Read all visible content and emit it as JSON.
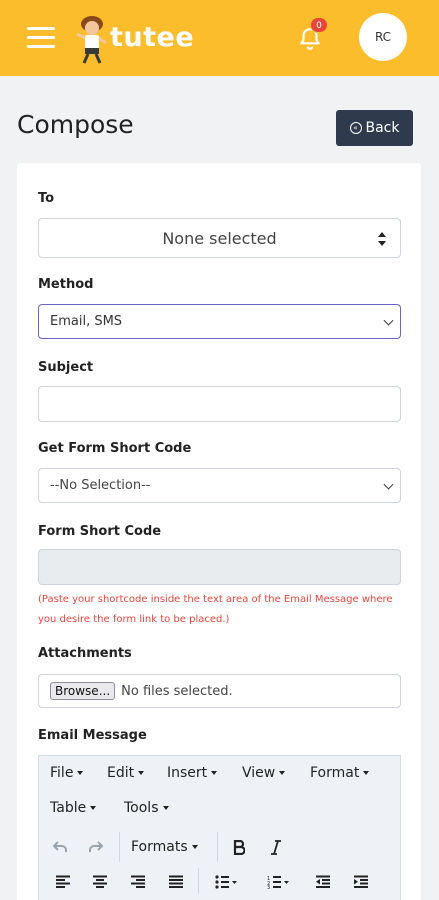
{
  "header": {
    "brand": "tutee",
    "notification_count": "0",
    "avatar_initials": "RC",
    "accent_color": "#fcbd2c"
  },
  "page": {
    "title": "Compose",
    "back_label": "Back"
  },
  "form": {
    "to_label": "To",
    "to_value": "None selected",
    "method_label": "Method",
    "method_value": "Email, SMS",
    "subject_label": "Subject",
    "subject_value": "",
    "form_short_code_select_label": "Get Form Short Code",
    "form_short_code_select_value": "--No Selection--",
    "form_short_code_label": "Form Short Code",
    "form_short_code_value": "",
    "hint": "(Paste your shortcode inside the text area of the Email Message where you desire the form link to be placed.)",
    "attachments_label": "Attachments",
    "browse_label": "Browse...",
    "no_files": "No files selected.",
    "email_message_label": "Email Message"
  },
  "editor": {
    "menus": [
      "File",
      "Edit",
      "Insert",
      "View",
      "Format",
      "Table",
      "Tools"
    ],
    "formats_label": "Formats",
    "toolbar_icons": [
      "undo-icon",
      "redo-icon",
      "bold-icon",
      "italic-icon",
      "align-left-icon",
      "align-center-icon",
      "align-right-icon",
      "align-justify-icon",
      "bullet-list-icon",
      "numbered-list-icon",
      "outdent-icon",
      "indent-icon"
    ]
  }
}
